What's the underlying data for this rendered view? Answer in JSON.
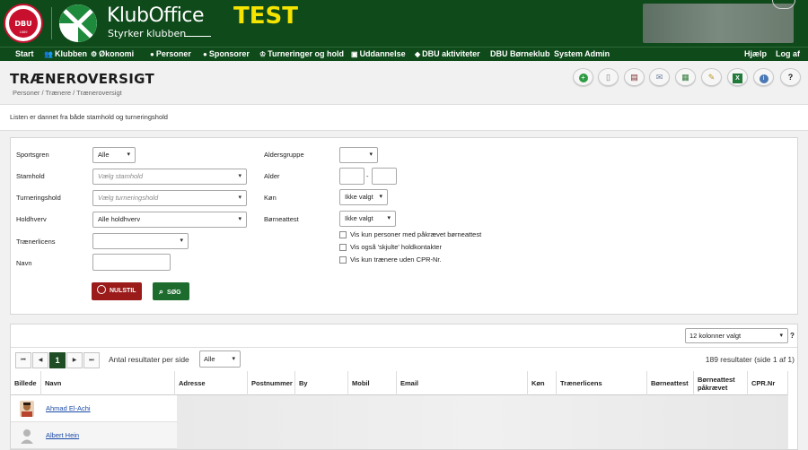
{
  "header": {
    "dbu_logo_text": "DBU",
    "dbu_logo_year": "1889",
    "brand_title": "KlubOffice",
    "brand_subtitle": "Styrker klubben",
    "environment_badge": "TEST",
    "accent_color": "#0f4a1b"
  },
  "nav": {
    "items": [
      {
        "label": "Start",
        "icon": ""
      },
      {
        "label": "Klubben",
        "icon": "people-icon"
      },
      {
        "label": "Økonomi",
        "icon": "coins-icon"
      },
      {
        "label": "Personer",
        "icon": "person-icon"
      },
      {
        "label": "Sponsorer",
        "icon": "sponsor-icon"
      },
      {
        "label": "Turneringer og hold",
        "icon": "trophy-icon"
      },
      {
        "label": "Uddannelse",
        "icon": "board-icon"
      },
      {
        "label": "DBU aktiviteter",
        "icon": "cap-icon"
      },
      {
        "label": "DBU Børneklub",
        "icon": ""
      },
      {
        "label": "System Admin",
        "icon": ""
      }
    ],
    "help": "Hjælp",
    "logout": "Log af"
  },
  "page": {
    "title": "TRÆNEROVERSIGT",
    "breadcrumb": "Personer / Trænere / Træneroversigt",
    "toolbar_icons": [
      "add-icon",
      "document-icon",
      "report-icon",
      "email-icon",
      "print-list-icon",
      "edit-icon",
      "excel-icon",
      "info-icon",
      "help-icon"
    ],
    "help_glyph": "?"
  },
  "info": {
    "text": "Listen er dannet fra både stamhold og turneringshold"
  },
  "filters": {
    "sportsgren": {
      "label": "Sportsgren",
      "value": "Alle"
    },
    "stamhold": {
      "label": "Stamhold",
      "placeholder": "Vælg stamhold"
    },
    "turneringshold": {
      "label": "Turneringshold",
      "placeholder": "Vælg turneringshold"
    },
    "holdhverv": {
      "label": "Holdhverv",
      "value": "Alle holdhverv"
    },
    "traenerlicens": {
      "label": "Trænerlicens",
      "value": ""
    },
    "navn": {
      "label": "Navn",
      "value": ""
    },
    "aldersgruppe": {
      "label": "Aldersgruppe",
      "value": ""
    },
    "alder": {
      "label": "Alder",
      "separator": "-"
    },
    "koen": {
      "label": "Køn",
      "value": "Ikke valgt"
    },
    "boerneattest": {
      "label": "Børneattest",
      "value": "Ikke valgt"
    },
    "checkboxes": [
      "Vis kun personer med påkrævet børneattest",
      "Vis også 'skjulte' holdkontakter",
      "Vis kun trænere uden CPR-Nr."
    ],
    "reset_label": "NULSTIL",
    "search_label": "SØG"
  },
  "results": {
    "columns_selected": "12 kolonner valgt",
    "help_glyph": "?",
    "pager": {
      "first": "⏮",
      "prev": "◀",
      "current": "1",
      "next": "▶",
      "last": "⏭"
    },
    "per_page_label": "Antal resultater per side",
    "per_page_value": "Alle",
    "count_text": "189 resultater (side 1 af 1)",
    "columns": [
      "Billede",
      "Navn",
      "Adresse",
      "Postnummer",
      "By",
      "Mobil",
      "Email",
      "Køn",
      "Trænerlicens",
      "Børneattest",
      "Børneattest påkrævet",
      "CPR.Nr"
    ],
    "rows": [
      {
        "name": "Ahmad El-Achi"
      },
      {
        "name": "Albert Hein"
      }
    ]
  }
}
